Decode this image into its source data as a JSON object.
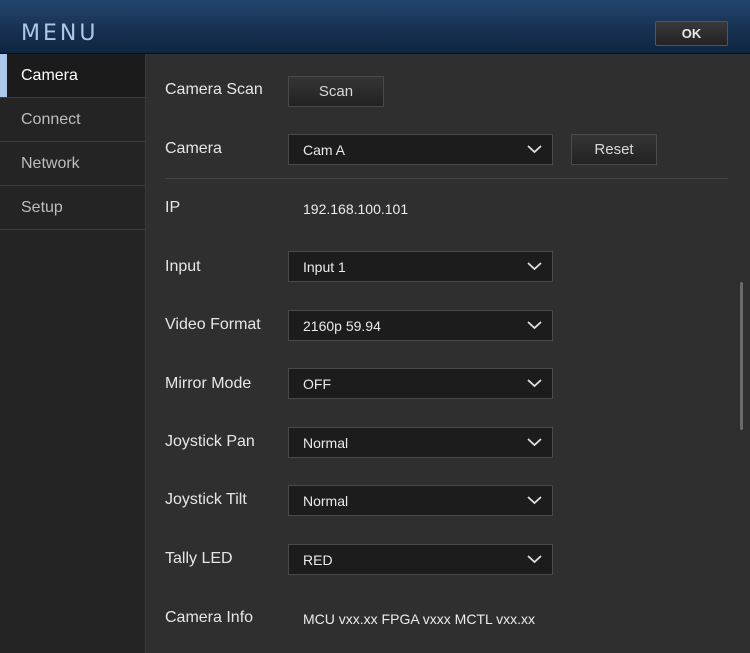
{
  "header": {
    "title": "MENU",
    "ok_label": "OK"
  },
  "sidebar": {
    "items": [
      {
        "label": "Camera",
        "active": true
      },
      {
        "label": "Connect",
        "active": false
      },
      {
        "label": "Network",
        "active": false
      },
      {
        "label": "Setup",
        "active": false
      }
    ]
  },
  "main": {
    "camera_scan": {
      "label": "Camera Scan",
      "button": "Scan"
    },
    "camera": {
      "label": "Camera",
      "value": "Cam A",
      "reset": "Reset"
    },
    "ip": {
      "label": "IP",
      "value": "192.168.100.101"
    },
    "input": {
      "label": "Input",
      "value": "Input 1"
    },
    "video_format": {
      "label": "Video Format",
      "value": "2160p 59.94"
    },
    "mirror_mode": {
      "label": "Mirror Mode",
      "value": "OFF"
    },
    "joystick_pan": {
      "label": "Joystick Pan",
      "value": "Normal"
    },
    "joystick_tilt": {
      "label": "Joystick Tilt",
      "value": "Normal"
    },
    "tally_led": {
      "label": "Tally LED",
      "value": "RED"
    },
    "camera_info": {
      "label": "Camera Info",
      "value": "MCU vxx.xx FPGA vxxx MCTL vxx.xx"
    }
  },
  "colors": {
    "accent": "#a9c8ec",
    "header": "#1a3a60",
    "background": "#2f2f2f"
  }
}
